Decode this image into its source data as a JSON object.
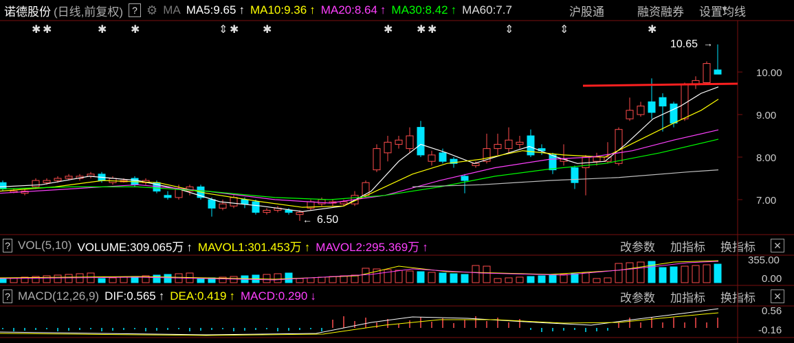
{
  "header": {
    "stock_name": "诺德股份",
    "mode": "(日线,前复权)",
    "help": "?",
    "ma_label": "MA",
    "ma5": "MA5:9.65",
    "ma10": "MA10:9.36",
    "ma20": "MA20:8.64",
    "ma30": "MA30:8.42",
    "ma60": "MA60:7.7",
    "arrow_up": "↑",
    "links": [
      "沪股通",
      "融资融券",
      "设置均线"
    ]
  },
  "price_panel": {
    "y_ticks": [
      "10.00",
      "9.00",
      "8.00",
      "7.00"
    ],
    "high_label": "10.65",
    "low_label": "6.50",
    "colors": {
      "up": "#ff4d4d",
      "down": "#00e5ff",
      "ma5": "#ffffff",
      "ma10": "#ffff00",
      "ma20": "#ff40ff",
      "ma30": "#00ff00",
      "ma60": "#c0c0c0"
    }
  },
  "vol_panel": {
    "title": "VOL(5,10)",
    "volume": "VOLUME:309.065万",
    "mavol1": "MAVOL1:301.453万",
    "mavol2": "MAVOL2:295.369万",
    "buttons": [
      "改参数",
      "加指标",
      "换指标"
    ],
    "y_ticks": [
      "355.00",
      "0.00"
    ]
  },
  "macd_panel": {
    "title": "MACD(12,26,9)",
    "dif": "DIF:0.565",
    "dea": "DEA:0.419",
    "macd": "MACD:0.290",
    "buttons": [
      "改参数",
      "加指标",
      "换指标"
    ],
    "y_ticks": [
      "0.56",
      "-0.16"
    ]
  },
  "icons": {
    "close": "close-icon",
    "gear": "gear-icon",
    "star": "star-icon",
    "collapse": "collapse-icon"
  }
}
